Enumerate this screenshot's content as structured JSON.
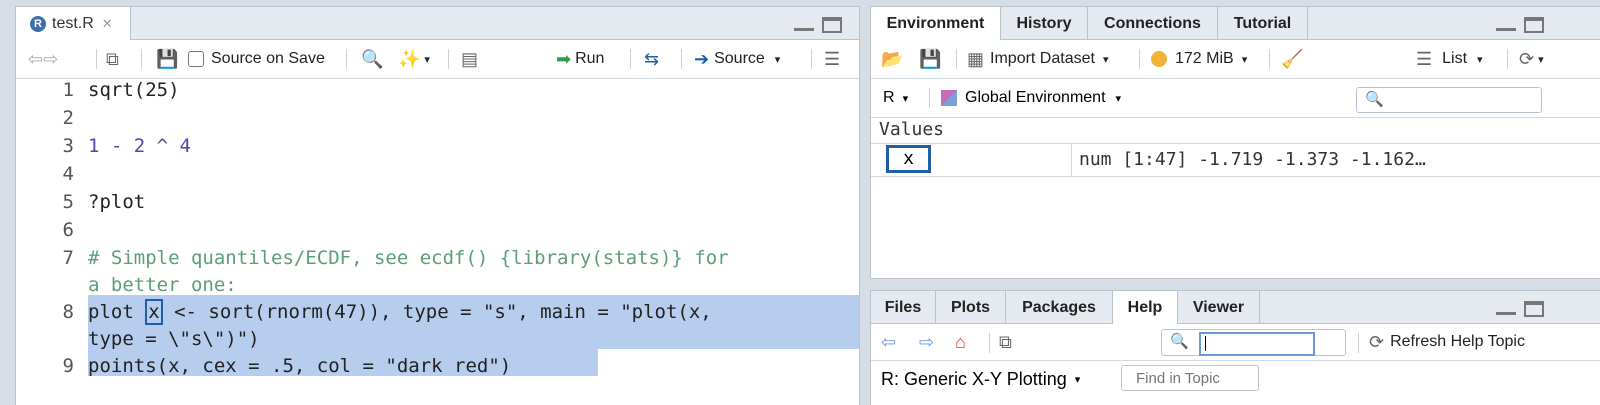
{
  "editor": {
    "file_tab": "test.R",
    "toolbar": {
      "source_on_save": "Source on Save",
      "run": "Run",
      "source": "Source"
    },
    "lines": [
      {
        "n": "1",
        "code": "sqrt(25)"
      },
      {
        "n": "2",
        "code": ""
      },
      {
        "n": "3",
        "code": "1 - 2 ^ 4"
      },
      {
        "n": "4",
        "code": ""
      },
      {
        "n": "5",
        "code": "?plot"
      },
      {
        "n": "6",
        "code": ""
      },
      {
        "n": "7",
        "code": "# Simple quantiles/ECDF, see ecdf() {library(stats)} for",
        "cont": "a better one:"
      },
      {
        "n": "8",
        "p1": "plot",
        "x": "x",
        "p2": " <- sort(rnorm(47)), type = \"s\", main = \"plot(x,",
        "cont": "type = \\\"s\\\")\")"
      },
      {
        "n": "9",
        "code": "points(x, cex = .5, col = \"dark red\")"
      }
    ]
  },
  "env": {
    "tabs": [
      "Environment",
      "History",
      "Connections",
      "Tutorial"
    ],
    "active_tab": "Environment",
    "import_dataset": "Import Dataset",
    "memory": "172 MiB",
    "view_mode": "List",
    "language": "R",
    "scope": "Global Environment",
    "section": "Values",
    "rows": [
      {
        "name": "x",
        "value": "num [1:47] -1.719 -1.373 -1.162…"
      }
    ]
  },
  "files": {
    "tabs": [
      "Files",
      "Plots",
      "Packages",
      "Help",
      "Viewer"
    ],
    "active_tab": "Help",
    "refresh": "Refresh Help Topic",
    "topic": "R: Generic X-Y Plotting",
    "find_placeholder": "Find in Topic"
  }
}
